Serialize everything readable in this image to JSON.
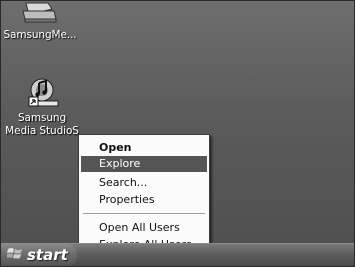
{
  "desktop": {
    "icons": [
      {
        "label": "SamsungMe...",
        "icon": "samsung-media-icon"
      },
      {
        "label_line1": "Samsung",
        "label_line2": "Media StudioS",
        "icon": "samsung-media-studio-icon"
      }
    ]
  },
  "context_menu": {
    "items": [
      {
        "label": "Open",
        "bold": true
      },
      {
        "label": "Explore",
        "highlighted": true
      },
      {
        "label": "Search..."
      },
      {
        "label": "Properties"
      },
      {
        "label": "Open All Users"
      },
      {
        "label": "Explore All Users"
      }
    ]
  },
  "taskbar": {
    "start_label": "start"
  },
  "colors": {
    "desktop": "#5c5c5c",
    "menu_background": "#fbfbfb",
    "menu_highlight": "#555555"
  }
}
